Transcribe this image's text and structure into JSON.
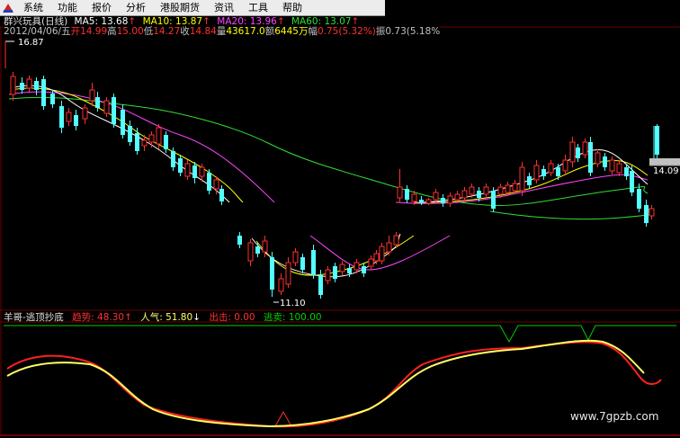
{
  "menu": [
    "系统",
    "功能",
    "报价",
    "分析",
    "港股期货",
    "资讯",
    "工具",
    "帮助"
  ],
  "header": {
    "stock": "群兴玩具(日线)",
    "ma": [
      {
        "label": "MA5: 13.68",
        "arrow": "↑",
        "color": "#ffffff"
      },
      {
        "label": "MA10: 13.87",
        "arrow": "↑",
        "color": "#ffff00"
      },
      {
        "label": "MA20: 13.96",
        "arrow": "↑",
        "color": "#ff44ff"
      },
      {
        "label": "MA60: 13.07",
        "arrow": "↑",
        "color": "#33dd33"
      }
    ]
  },
  "quote": {
    "date": "2012/04/06/五",
    "open_label": "开",
    "open": "14.99",
    "high_label": "高",
    "high": "15.00",
    "low_label": "低",
    "low": "14.27",
    "close_label": "收",
    "close": "14.84",
    "vol_label": "量",
    "vol": "43617.0",
    "amt_label": "额",
    "amt": "6445万",
    "chg_label": "幅",
    "chg": "0.75(5.32%)",
    "amp_label": "振",
    "amp": "0.73(5.18%"
  },
  "price_high_marker": "16.87",
  "price_low_marker": "11.10",
  "current_price": "14.09",
  "indicator": {
    "name": "羊哥-逃顶抄底",
    "trend_label": "趋势: 48.30",
    "trend_arrow": "↑",
    "pop_label": "人气: 51.80",
    "pop_arrow": "↓",
    "out_label": "出击: 0.00",
    "escape_label": "逃卖: 100.00"
  },
  "watermark": "www.7gpzb.com",
  "colors": {
    "up": "#ff3030",
    "down": "#54ffff",
    "ma5": "#ffffff",
    "ma10": "#ffff00",
    "ma20": "#ff44ff",
    "ma60": "#33dd33",
    "trend": "#ff2020",
    "pop": "#ffff66",
    "escape": "#00cc00",
    "menu_bg": "#ececec",
    "background": "#000000"
  }
}
